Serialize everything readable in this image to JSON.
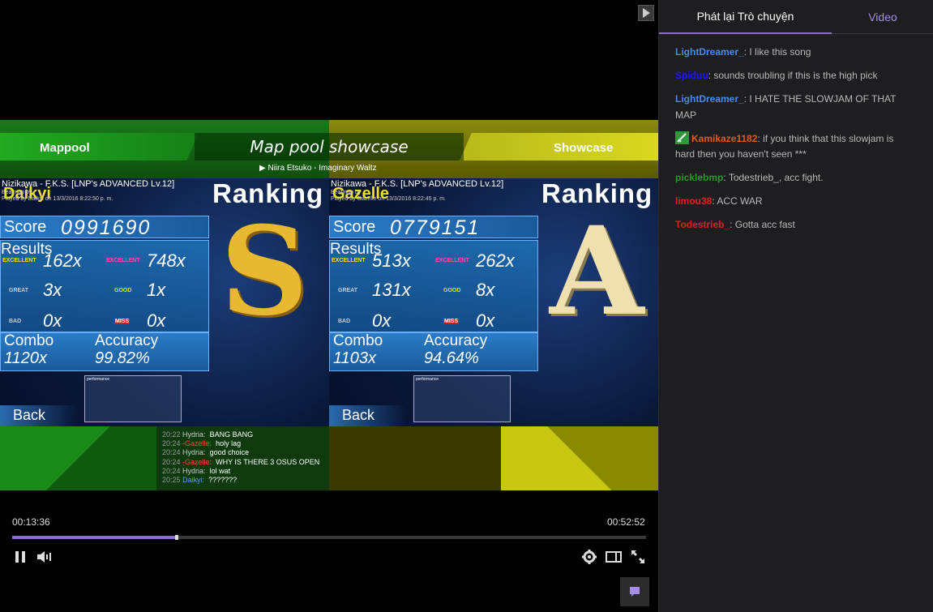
{
  "overlay": {
    "left_label": "Mappool",
    "title": "Map pool showcase",
    "right_label": "Showcase",
    "now_playing": "Niira Etsuko - Imaginary Waltz",
    "panels": [
      {
        "song": "Nizikawa - F.K.S. [LNP's ADVANCED Lv.12]",
        "player": "Daikyi",
        "sub": "Beatmap by",
        "played": "Played by Daikyi on 13/3/2016 8:22:50 p. m.",
        "ranking": "Ranking",
        "score_label": "Score",
        "score": "0991690",
        "results_label": "Results",
        "h1_label": "EXCELLENT",
        "h1": "162x",
        "h2_label": "EXCELLENT",
        "h2": "748x",
        "h3_label": "GREAT",
        "h3": "3x",
        "h4_label": "GOOD",
        "h4": "1x",
        "h5_label": "BAD",
        "h5": "0x",
        "h6_label": "MISS",
        "h6": "0x",
        "combo_label": "Combo",
        "combo": "1120x",
        "acc_label": "Accuracy",
        "acc": "99.82%",
        "grade": "S",
        "perf_label": "performance",
        "back": "Back"
      },
      {
        "song": "Nizikawa - F.K.S. [LNP's ADVANCED Lv.12]",
        "player": "Gazelle",
        "sub": "Beatmap by",
        "played": "Played by Gazelle on 13/3/2016 8:22:45 p. m.",
        "ranking": "Ranking",
        "score_label": "Score",
        "score": "0779151",
        "results_label": "Results",
        "h1_label": "EXCELLENT",
        "h1": "513x",
        "h2_label": "EXCELLENT",
        "h2": "262x",
        "h3_label": "GREAT",
        "h3": "131x",
        "h4_label": "GOOD",
        "h4": "8x",
        "h5_label": "BAD",
        "h5": "0x",
        "h6_label": "MISS",
        "h6": "0x",
        "combo_label": "Combo",
        "combo": "1103x",
        "acc_label": "Accuracy",
        "acc": "94.64%",
        "grade": "A",
        "perf_label": "performance",
        "back": "Back"
      }
    ],
    "chatlog": [
      {
        "time": "20:22",
        "name": "Hydria:",
        "text": "BANG BANG",
        "color": "#cccccc"
      },
      {
        "time": "20:24",
        "name": "-Gazelle:",
        "text": "holy lag",
        "color": "#ff4040"
      },
      {
        "time": "20:24",
        "name": "Hydria:",
        "text": "good choice",
        "color": "#cccccc"
      },
      {
        "time": "20:24",
        "name": "-Gazelle:",
        "text": "WHY IS THERE 3 OSUS OPEN",
        "color": "#ff4040"
      },
      {
        "time": "20:24",
        "name": "Hydria:",
        "text": "lol wat",
        "color": "#cccccc"
      },
      {
        "time": "20:25",
        "name": "Daikyi:",
        "text": "???????",
        "color": "#5a9aff"
      }
    ]
  },
  "controls": {
    "time_current": "00:13:36",
    "time_total": "00:52:52",
    "progress": 0.26
  },
  "chat": {
    "tabs": [
      "Phát lại Trò chuyện",
      "Video"
    ],
    "messages": [
      {
        "user": "LightDreamer_",
        "color": "#4a8ae8",
        "text": "I like this song",
        "badge": false
      },
      {
        "user": "Spiduu",
        "color": "#1a1aff",
        "text": "sounds troubling if this is the high pick",
        "badge": false
      },
      {
        "user": "LightDreamer_",
        "color": "#4a8ae8",
        "text": "I HATE THE SLOWJAM OF THAT MAP",
        "badge": false
      },
      {
        "user": "Kamikaze1182",
        "color": "#e05a1a",
        "text": "if you think that this slowjam is hard then you haven't seen ***",
        "badge": true
      },
      {
        "user": "picklebmp",
        "color": "#2a9a2a",
        "text": "Todestrieb_, acc fight.",
        "badge": false
      },
      {
        "user": "limou38",
        "color": "#e02020",
        "text": "ACC WAR",
        "badge": false
      },
      {
        "user": "Todestrieb_",
        "color": "#e02020",
        "text": "Gotta acc fast",
        "badge": false
      }
    ]
  },
  "colors": {
    "accent": "#8a6ec8",
    "chat_bg": "#1e1e20"
  }
}
